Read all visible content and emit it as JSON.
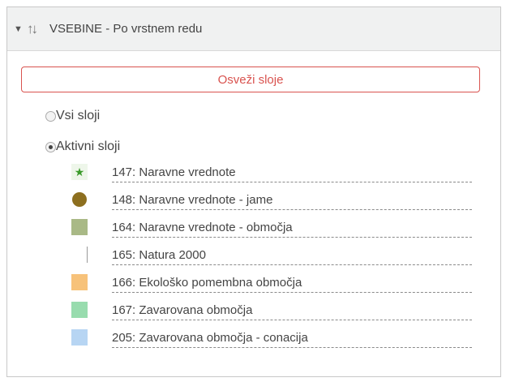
{
  "header": {
    "title": "VSEBINE - Po vrstnem redu"
  },
  "refresh_label": "Osveži sloje",
  "radios": [
    {
      "label": "Vsi sloji",
      "checked": false
    },
    {
      "label": "Aktivni sloji",
      "checked": true
    }
  ],
  "layers": [
    {
      "label": "147: Naravne vrednote",
      "symbol": "star-icon",
      "color": "#3a9a2a"
    },
    {
      "label": "148: Naravne vrednote - jame",
      "symbol": "circle-icon",
      "color": "#8d6f1f"
    },
    {
      "label": "164: Naravne vrednote - območja",
      "symbol": "square-icon",
      "color": "#a9b986"
    },
    {
      "label": "165: Natura 2000",
      "symbol": "empty-icon",
      "color": "#ffffff"
    },
    {
      "label": "166: Ekološko pomembna območja",
      "symbol": "square-icon",
      "color": "#f7c27a"
    },
    {
      "label": "167: Zavarovana območja",
      "symbol": "square-icon",
      "color": "#98dcae"
    },
    {
      "label": "205: Zavarovana območja - conacija",
      "symbol": "square-icon",
      "color": "#b7d5f3"
    }
  ]
}
